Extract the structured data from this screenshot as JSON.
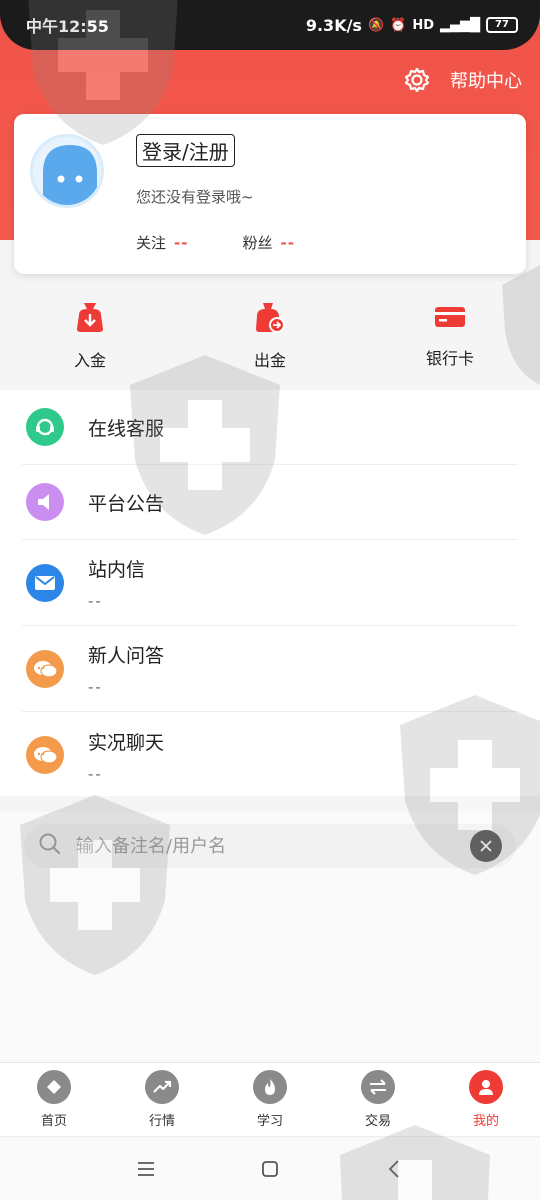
{
  "status_bar": {
    "time": "中午12:55",
    "network_speed": "9.3K/s",
    "battery": "77"
  },
  "header": {
    "help_label": "帮助中心",
    "settings_icon": "gear-icon"
  },
  "profile": {
    "login_label": "登录/注册",
    "status_text": "您还没有登录哦~",
    "follow_label": "关注",
    "follow_value": "--",
    "fans_label": "粉丝",
    "fans_value": "--"
  },
  "quick_actions": [
    {
      "label": "入金",
      "icon": "deposit-bag-icon"
    },
    {
      "label": "出金",
      "icon": "withdraw-bag-icon"
    },
    {
      "label": "银行卡",
      "icon": "bank-card-icon"
    }
  ],
  "menu": [
    {
      "title": "在线客服",
      "subtitle": "",
      "icon": "headset-icon",
      "color": "#2ec98b"
    },
    {
      "title": "平台公告",
      "subtitle": "",
      "icon": "speaker-icon",
      "color": "#c98ef0"
    },
    {
      "title": "站内信",
      "subtitle": "--",
      "icon": "mail-icon",
      "color": "#2c86e8"
    },
    {
      "title": "新人问答",
      "subtitle": "--",
      "icon": "chat-icon",
      "color": "#f39a4b"
    },
    {
      "title": "实况聊天",
      "subtitle": "--",
      "icon": "chat-icon",
      "color": "#f39a4b"
    }
  ],
  "search": {
    "placeholder": "输入备注名/用户名",
    "value": ""
  },
  "tabs": [
    {
      "label": "首页",
      "icon": "home-diamond-icon",
      "active": false
    },
    {
      "label": "行情",
      "icon": "trend-icon",
      "active": false
    },
    {
      "label": "学习",
      "icon": "flame-icon",
      "active": false
    },
    {
      "label": "交易",
      "icon": "swap-icon",
      "active": false
    },
    {
      "label": "我的",
      "icon": "user-icon",
      "active": true
    }
  ],
  "colors": {
    "brand_red": "#f05348",
    "active_tab": "#ef3b36"
  }
}
